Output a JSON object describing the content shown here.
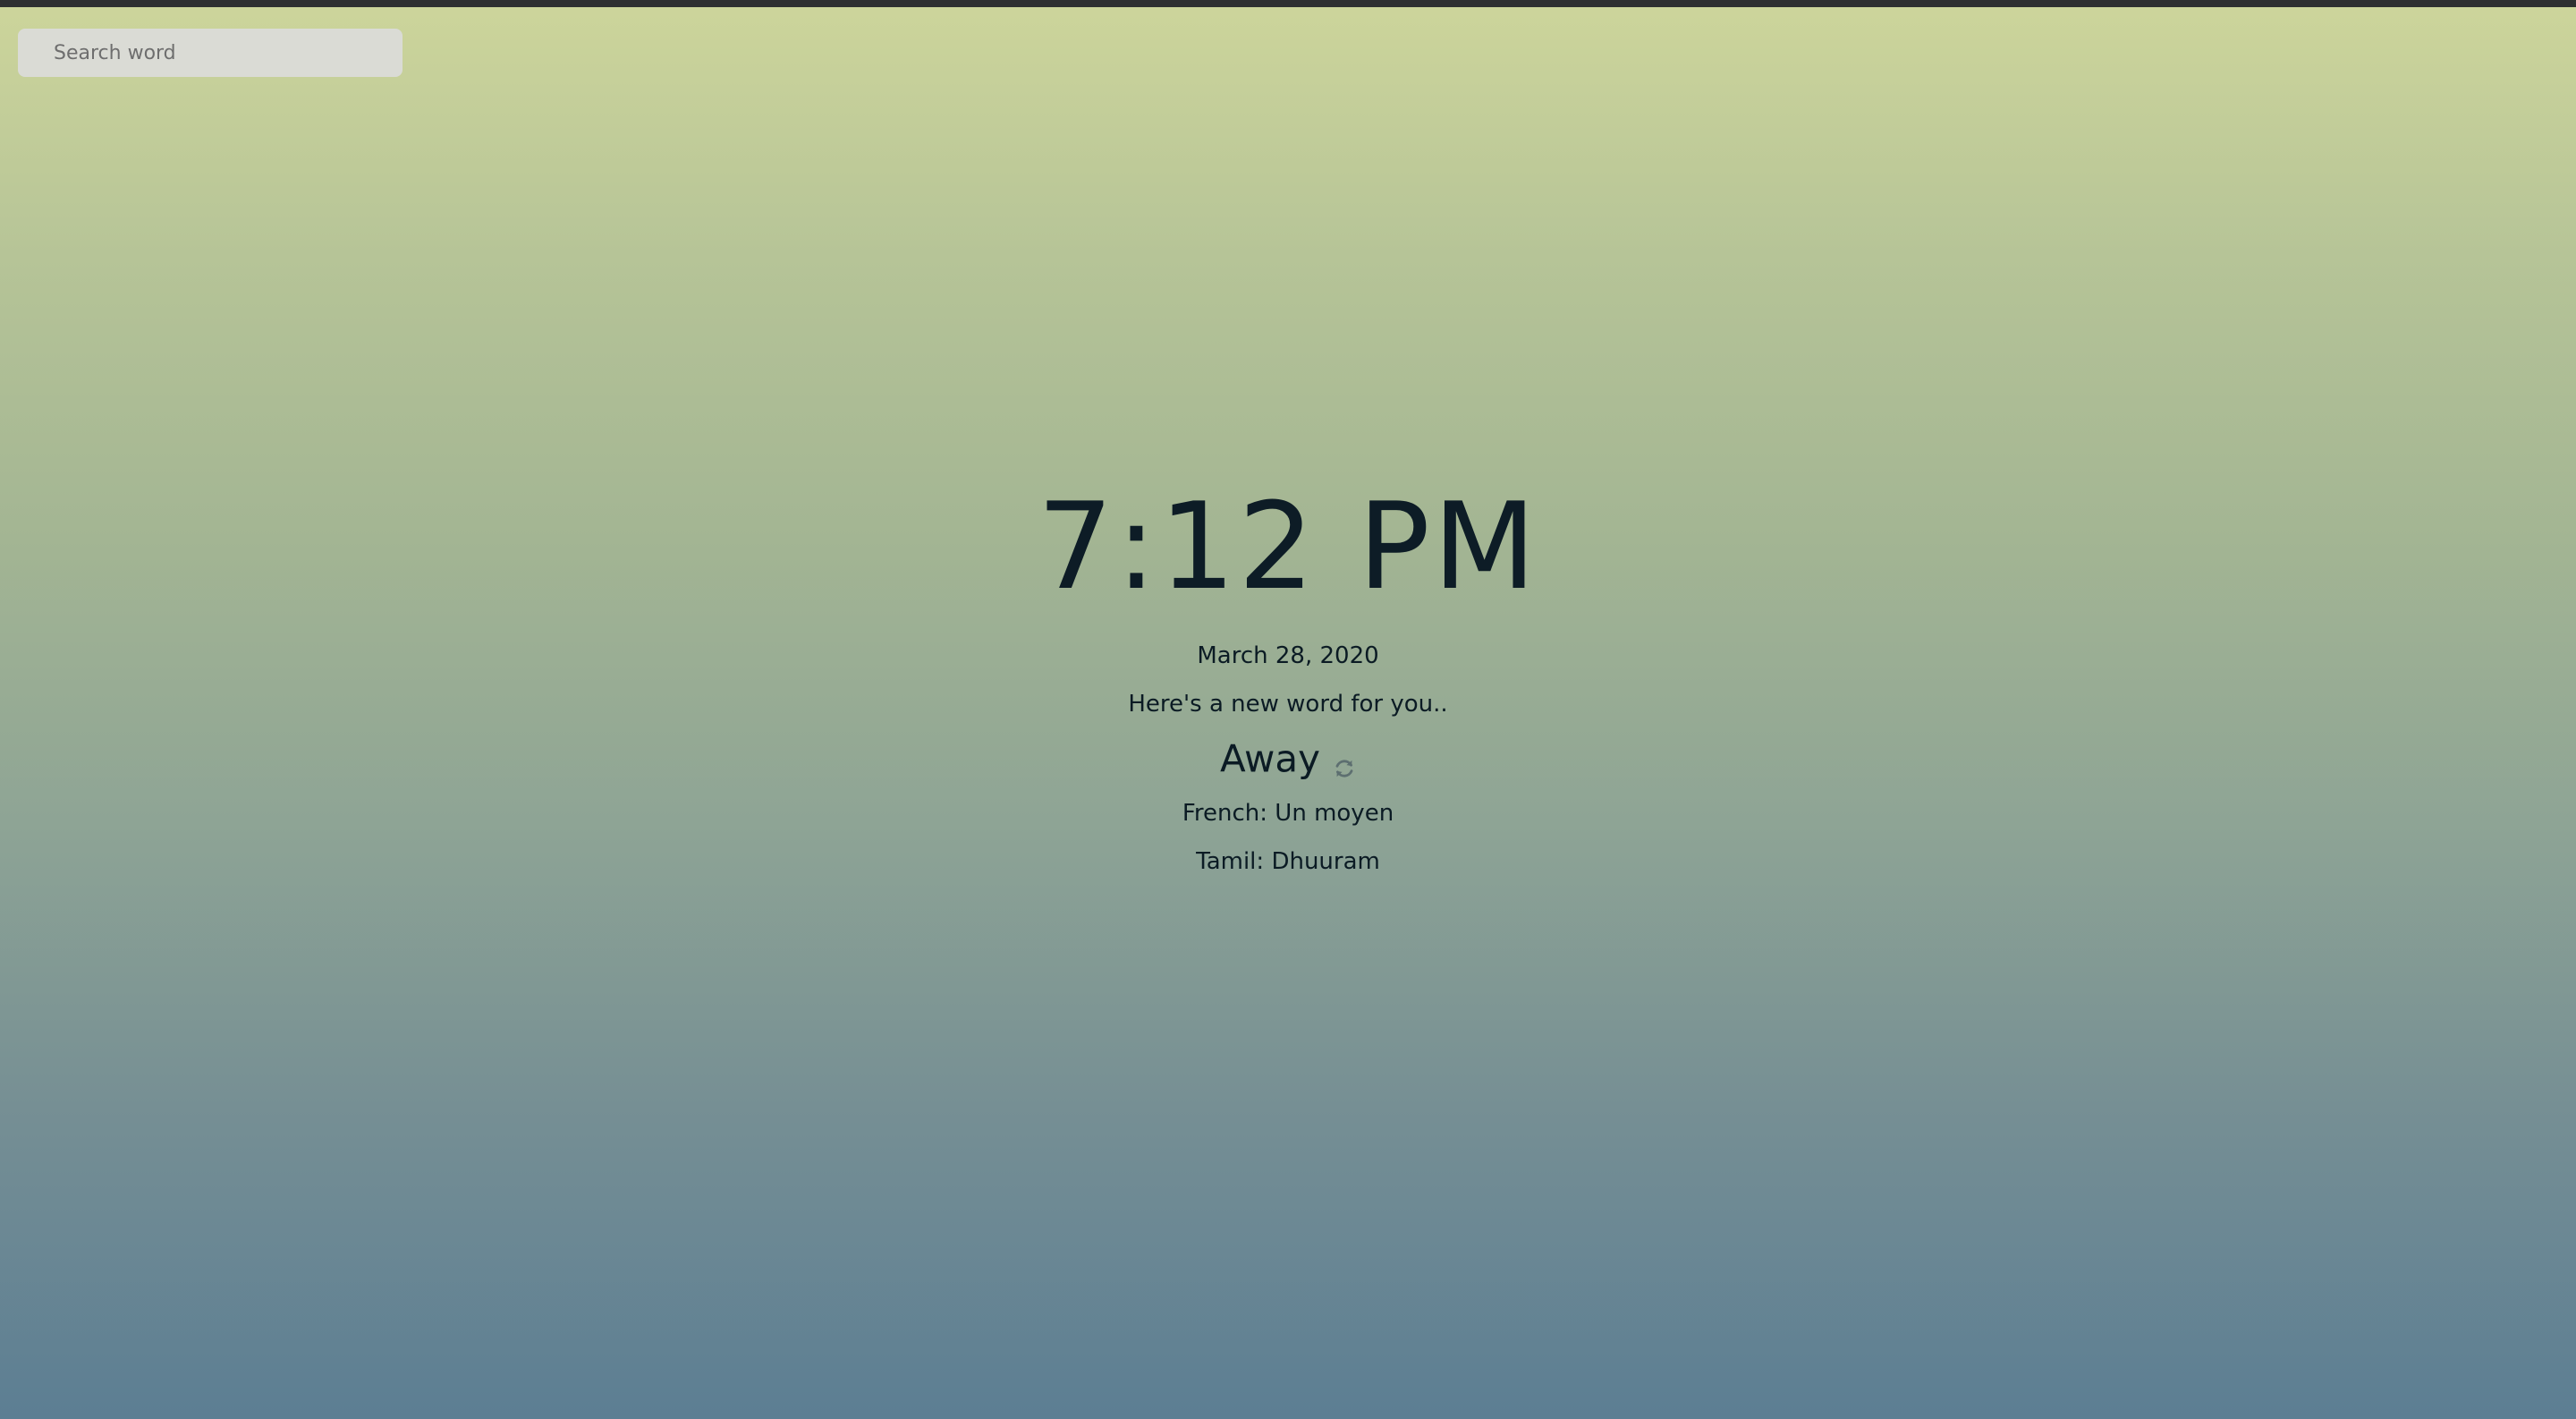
{
  "search": {
    "placeholder": "Search word",
    "value": ""
  },
  "clock": {
    "time": "7:12 PM",
    "date": "March 28, 2020"
  },
  "word_of_day": {
    "prompt": "Here's a new word for you..",
    "word": "Away",
    "refresh_icon": "refresh-icon",
    "translations": [
      {
        "language": "French",
        "text": "Un moyen"
      },
      {
        "language": "Tamil",
        "text": "Dhuuram"
      }
    ]
  },
  "colors": {
    "gradient_top": "#cdd59b",
    "gradient_bottom": "#5c7e93",
    "text": "#0b1b24",
    "top_strip": "#2e2f31"
  }
}
